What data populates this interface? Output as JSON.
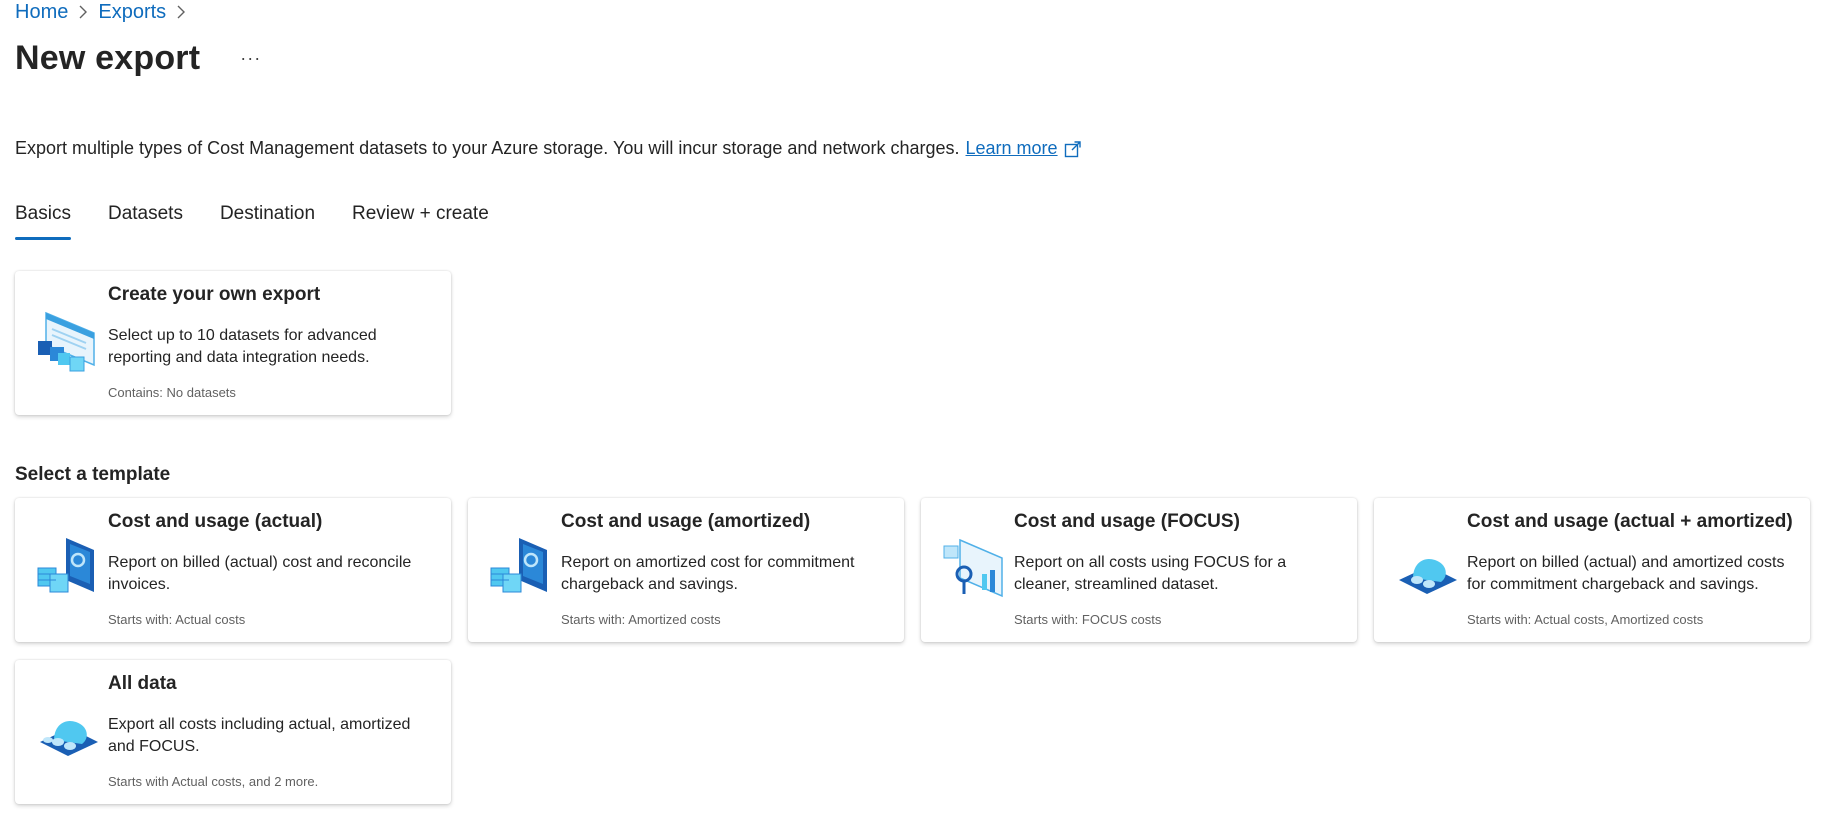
{
  "breadcrumb": {
    "home": "Home",
    "exports": "Exports"
  },
  "header": {
    "title": "New export",
    "more": "···"
  },
  "description": {
    "text": "Export multiple types of Cost Management datasets to your Azure storage. You will incur storage and network charges.",
    "link": "Learn more"
  },
  "tabs": [
    {
      "label": "Basics",
      "active": true
    },
    {
      "label": "Datasets",
      "active": false
    },
    {
      "label": "Destination",
      "active": false
    },
    {
      "label": "Review + create",
      "active": false
    }
  ],
  "custom_card": {
    "title": "Create your own export",
    "description": "Select up to 10 datasets for advanced reporting and data integration needs.",
    "meta": "Contains: No datasets",
    "icon": "custom-export-icon"
  },
  "templates_heading": "Select a template",
  "templates": [
    {
      "title": "Cost and usage (actual)",
      "description": "Report on billed (actual) cost and reconcile invoices.",
      "meta": "Starts with: Actual costs",
      "icon": "actual-cost-icon"
    },
    {
      "title": "Cost and usage (amortized)",
      "description": "Report on amortized cost for commitment chargeback and savings.",
      "meta": "Starts with: Amortized costs",
      "icon": "amortized-cost-icon"
    },
    {
      "title": "Cost and usage (FOCUS)",
      "description": "Report on all costs using FOCUS for a cleaner, streamlined dataset.",
      "meta": "Starts with: FOCUS costs",
      "icon": "focus-cost-icon"
    },
    {
      "title": "Cost and usage (actual + amortized)",
      "description": "Report on billed (actual) and amortized costs for commitment chargeback and savings.",
      "meta": "Starts with: Actual costs, Amortized costs",
      "icon": "actual-amortized-icon"
    },
    {
      "title": "All data",
      "description": "Export all costs including actual, amortized and FOCUS.",
      "meta": "Starts with Actual costs, and 2 more.",
      "icon": "all-data-icon"
    }
  ],
  "colors": {
    "accent": "#0f6cbd",
    "text": "#242424",
    "muted": "#616161"
  }
}
